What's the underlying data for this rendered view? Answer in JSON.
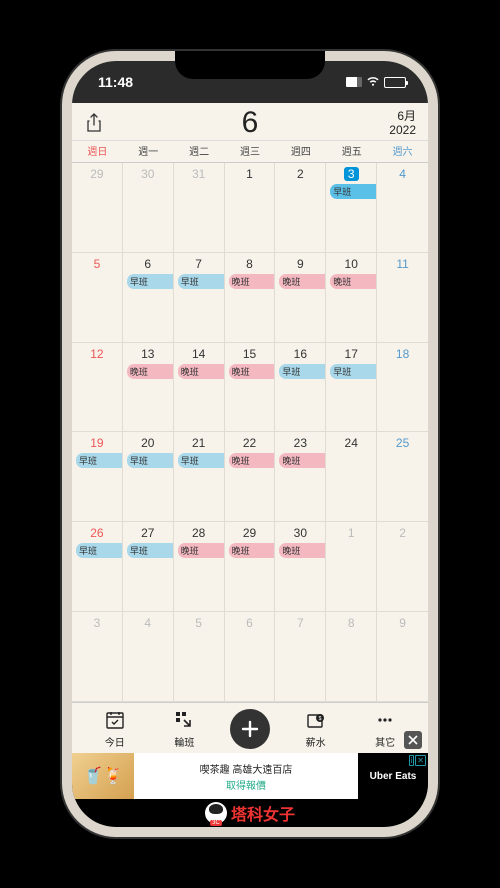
{
  "status": {
    "time": "11:48"
  },
  "header": {
    "month_number": "6",
    "month_label": "6月",
    "year": "2022"
  },
  "weekdays": [
    "週日",
    "週一",
    "週二",
    "週三",
    "週四",
    "週五",
    "週六"
  ],
  "shifts": {
    "early": "早班",
    "late": "晚班"
  },
  "calendar": {
    "rows": [
      [
        {
          "n": "29",
          "cls": "other"
        },
        {
          "n": "30",
          "cls": "other"
        },
        {
          "n": "31",
          "cls": "other"
        },
        {
          "n": "1"
        },
        {
          "n": "2"
        },
        {
          "n": "3",
          "today": true,
          "shift": "early",
          "shiftCls": "today-shift"
        },
        {
          "n": "4",
          "cls": "sat"
        }
      ],
      [
        {
          "n": "5",
          "cls": "sun"
        },
        {
          "n": "6",
          "shift": "early",
          "shiftCls": "early"
        },
        {
          "n": "7",
          "shift": "early",
          "shiftCls": "early"
        },
        {
          "n": "8",
          "shift": "late",
          "shiftCls": "late"
        },
        {
          "n": "9",
          "shift": "late",
          "shiftCls": "late"
        },
        {
          "n": "10",
          "shift": "late",
          "shiftCls": "late"
        },
        {
          "n": "11",
          "cls": "sat"
        }
      ],
      [
        {
          "n": "12",
          "cls": "sun"
        },
        {
          "n": "13",
          "shift": "late",
          "shiftCls": "late"
        },
        {
          "n": "14",
          "shift": "late",
          "shiftCls": "late"
        },
        {
          "n": "15",
          "shift": "late",
          "shiftCls": "late"
        },
        {
          "n": "16",
          "shift": "early",
          "shiftCls": "early"
        },
        {
          "n": "17",
          "shift": "early",
          "shiftCls": "early"
        },
        {
          "n": "18",
          "cls": "sat"
        }
      ],
      [
        {
          "n": "19",
          "cls": "sun",
          "shift": "early",
          "shiftCls": "early"
        },
        {
          "n": "20",
          "shift": "early",
          "shiftCls": "early"
        },
        {
          "n": "21",
          "shift": "early",
          "shiftCls": "early"
        },
        {
          "n": "22",
          "shift": "late",
          "shiftCls": "late"
        },
        {
          "n": "23",
          "shift": "late",
          "shiftCls": "late"
        },
        {
          "n": "24"
        },
        {
          "n": "25",
          "cls": "sat"
        }
      ],
      [
        {
          "n": "26",
          "cls": "sun",
          "shift": "early",
          "shiftCls": "early"
        },
        {
          "n": "27",
          "shift": "early",
          "shiftCls": "early"
        },
        {
          "n": "28",
          "shift": "late",
          "shiftCls": "late"
        },
        {
          "n": "29",
          "shift": "late",
          "shiftCls": "late"
        },
        {
          "n": "30",
          "shift": "late",
          "shiftCls": "late"
        },
        {
          "n": "1",
          "cls": "other"
        },
        {
          "n": "2",
          "cls": "other"
        }
      ],
      [
        {
          "n": "3",
          "cls": "other"
        },
        {
          "n": "4",
          "cls": "other"
        },
        {
          "n": "5",
          "cls": "other"
        },
        {
          "n": "6",
          "cls": "other"
        },
        {
          "n": "7",
          "cls": "other"
        },
        {
          "n": "8",
          "cls": "other"
        },
        {
          "n": "9",
          "cls": "other"
        }
      ]
    ]
  },
  "toolbar": {
    "today": "今日",
    "shift": "輪班",
    "salary": "薪水",
    "other": "其它"
  },
  "ad": {
    "line1": "喫茶趣 高雄大遠百店",
    "line2": "取得報價",
    "right": "Uber Eats"
  },
  "brand": {
    "badge": "3C",
    "text": "塔科女子"
  }
}
